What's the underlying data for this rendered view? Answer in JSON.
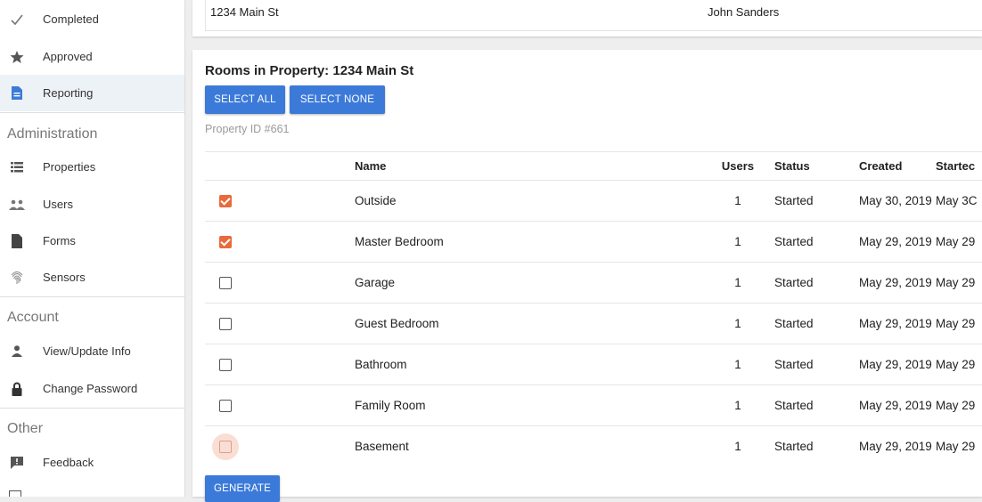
{
  "sidebar": {
    "items_top": [
      {
        "label": "Completed",
        "icon": "check-icon"
      },
      {
        "label": "Approved",
        "icon": "star-icon"
      },
      {
        "label": "Reporting",
        "icon": "document-icon",
        "active": true
      }
    ],
    "administration": {
      "heading": "Administration",
      "items": [
        {
          "label": "Properties",
          "icon": "list-icon"
        },
        {
          "label": "Users",
          "icon": "people-icon"
        },
        {
          "label": "Forms",
          "icon": "file-icon"
        },
        {
          "label": "Sensors",
          "icon": "fingerprint-icon"
        }
      ]
    },
    "account": {
      "heading": "Account",
      "items": [
        {
          "label": "View/Update Info",
          "icon": "person-icon"
        },
        {
          "label": "Change Password",
          "icon": "lock-icon"
        }
      ]
    },
    "other": {
      "heading": "Other",
      "items": [
        {
          "label": "Feedback",
          "icon": "feedback-icon"
        }
      ]
    }
  },
  "top_row": {
    "address": "1234 Main St",
    "owner": "John Sanders"
  },
  "main": {
    "title": "Rooms in Property: 1234 Main St",
    "select_all": "SELECT ALL",
    "select_none": "SELECT NONE",
    "property_id": "Property ID #661",
    "generate": "GENERATE"
  },
  "table": {
    "headers": {
      "name": "Name",
      "users": "Users",
      "status": "Status",
      "created": "Created",
      "started": "Startec"
    },
    "rows": [
      {
        "checked": true,
        "name": "Outside",
        "users": "1",
        "status": "Started",
        "created": "May 30, 2019",
        "started": "May 3C"
      },
      {
        "checked": true,
        "name": "Master Bedroom",
        "users": "1",
        "status": "Started",
        "created": "May 29, 2019",
        "started": "May 29"
      },
      {
        "checked": false,
        "name": "Garage",
        "users": "1",
        "status": "Started",
        "created": "May 29, 2019",
        "started": "May 29"
      },
      {
        "checked": false,
        "name": "Guest Bedroom",
        "users": "1",
        "status": "Started",
        "created": "May 29, 2019",
        "started": "May 29"
      },
      {
        "checked": false,
        "name": "Bathroom",
        "users": "1",
        "status": "Started",
        "created": "May 29, 2019",
        "started": "May 29"
      },
      {
        "checked": false,
        "name": "Family Room",
        "users": "1",
        "status": "Started",
        "created": "May 29, 2019",
        "started": "May 29"
      },
      {
        "checked": false,
        "name": "Basement",
        "users": "1",
        "status": "Started",
        "created": "May 29, 2019",
        "started": "May 29",
        "focused": true
      }
    ]
  },
  "colors": {
    "primary": "#3c7ad9",
    "checkbox_checked": "#e96a3c",
    "active_nav_bg": "#edf2f7"
  }
}
